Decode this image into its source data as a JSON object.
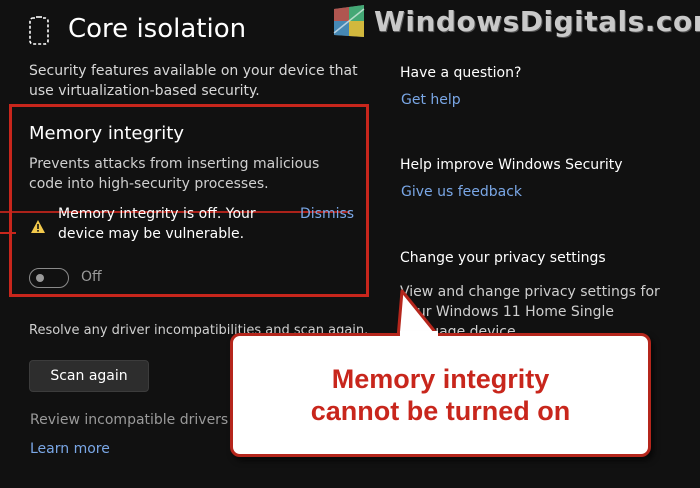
{
  "header": {
    "title": "Core isolation",
    "icon": "core-isolation-icon"
  },
  "watermark": {
    "text": "WindowsDigitals.com",
    "logo": "windows-logo"
  },
  "intro": "Security features available on your device that use virtualization-based security.",
  "memory_integrity": {
    "title": "Memory integrity",
    "description": "Prevents attacks from inserting malicious code into high-security processes.",
    "warning": "Memory integrity is off. Your device may be vulnerable.",
    "warning_icon": "warning-icon",
    "dismiss": "Dismiss",
    "toggle_state": "Off",
    "highlight_color": "#c8261c"
  },
  "resolve_text": "Resolve any driver incompatibilities and scan again.",
  "scan_button": "Scan again",
  "review_text": "Review incompatible drivers",
  "learn_more": "Learn more",
  "sidebar": {
    "question_heading": "Have a question?",
    "get_help": "Get help",
    "improve_heading": "Help improve Windows Security",
    "feedback": "Give us feedback",
    "privacy_heading": "Change your privacy settings",
    "privacy_desc": "View and change privacy settings for your Windows 11 Home Single language device."
  },
  "callout": {
    "line1": "Memory integrity",
    "line2": "cannot be turned on",
    "text_color": "#c8261c"
  },
  "colors": {
    "background": "#111111",
    "link": "#7aa7e6",
    "accent_red": "#c8261c"
  }
}
